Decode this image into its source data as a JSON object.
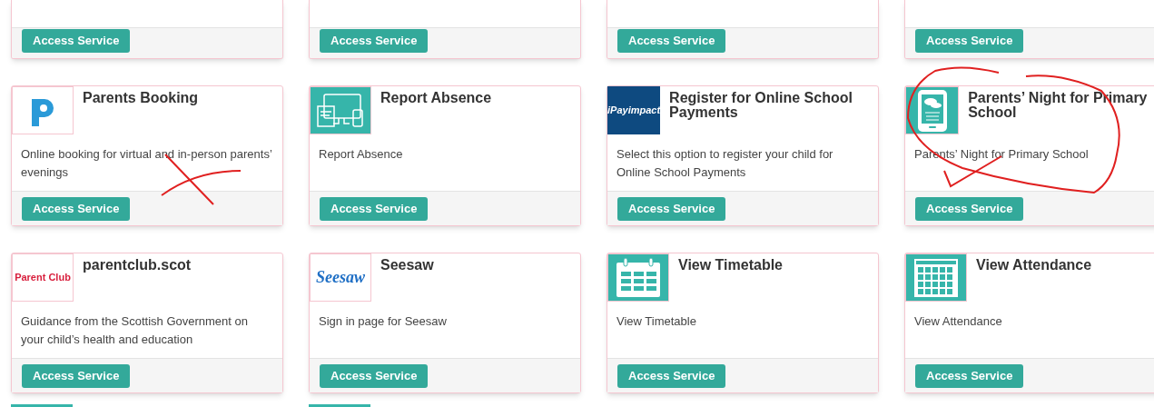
{
  "top_row": [
    {
      "button": "Access Service"
    },
    {
      "button": "Access Service"
    },
    {
      "button": "Access Service"
    },
    {
      "button": "Access Service"
    }
  ],
  "services": [
    {
      "kind": "p-logo",
      "title": "Parents Booking",
      "description": "Online booking for virtual and in-person parents’ evenings",
      "button": "Access Service"
    },
    {
      "kind": "devices",
      "title": "Report Absence",
      "description": "Report Absence",
      "button": "Access Service"
    },
    {
      "kind": "ipay",
      "logo_text": "iPayimpact",
      "title": "Register for Online School Payments",
      "description": "Select this option to register your child for Online School Payments",
      "button": "Access Service"
    },
    {
      "kind": "phone",
      "title": "Parents’ Night for Primary School",
      "description": "Parents’ Night for Primary School",
      "button": "Access Service"
    },
    {
      "kind": "parentclub",
      "logo_text": "Parent Club",
      "title": "parentclub.scot",
      "description": "Guidance from the Scottish Government on your child’s health and education",
      "button": "Access Service"
    },
    {
      "kind": "seesaw",
      "logo_text": "Seesaw",
      "title": "Seesaw",
      "description": "Sign in page for Seesaw",
      "button": "Access Service"
    },
    {
      "kind": "timetable",
      "title": "View Timetable",
      "description": "View Timetable",
      "button": "Access Service"
    },
    {
      "kind": "attendance",
      "title": "View Attendance",
      "description": "View Attendance",
      "button": "Access Service"
    }
  ],
  "annotations": {
    "cross_mark": true,
    "circle_mark": true
  }
}
